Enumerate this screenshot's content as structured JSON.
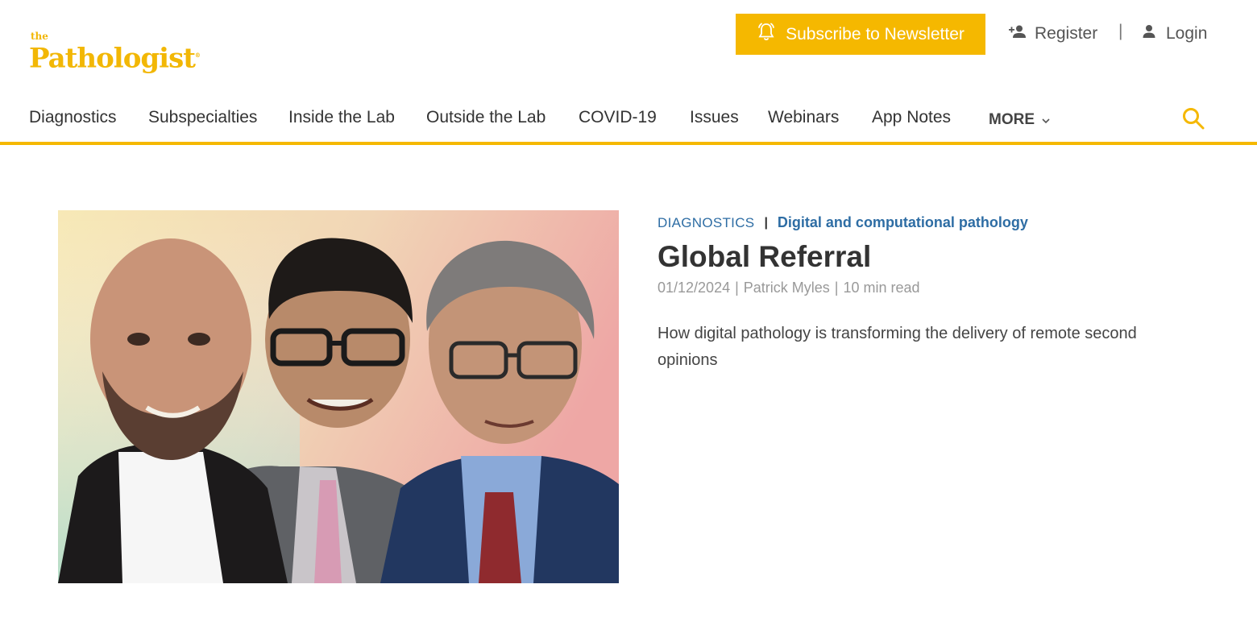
{
  "brand": {
    "logo_small": "the",
    "logo_main": "Pathologist",
    "logo_reg": "®",
    "accent_color": "#f5b800",
    "link_color": "#2e6da4"
  },
  "header": {
    "subscribe_label": "Subscribe to Newsletter",
    "subscribe_icon": "bell-icon",
    "register_label": "Register",
    "register_icon": "add-user-icon",
    "separator": "|",
    "login_label": "Login",
    "login_icon": "user-icon"
  },
  "nav": {
    "items": [
      {
        "label": "Diagnostics"
      },
      {
        "label": "Subspecialties"
      },
      {
        "label": "Inside the Lab"
      },
      {
        "label": "Outside the Lab"
      },
      {
        "label": "COVID-19"
      },
      {
        "label": "Issues"
      },
      {
        "label": "Webinars"
      },
      {
        "label": "App Notes"
      }
    ],
    "more_label": "MORE",
    "more_icon": "chevron-down-icon",
    "search_icon": "search-icon"
  },
  "article": {
    "category": "DIAGNOSTICS",
    "category_separator": "|",
    "subcategory": "Digital and computational pathology",
    "title": "Global Referral",
    "date": "01/12/2024",
    "meta_separator": "|",
    "author": "Patrick Myles",
    "read_time": "10 min read",
    "description": "How digital pathology is transforming the delivery of remote second opinions"
  }
}
